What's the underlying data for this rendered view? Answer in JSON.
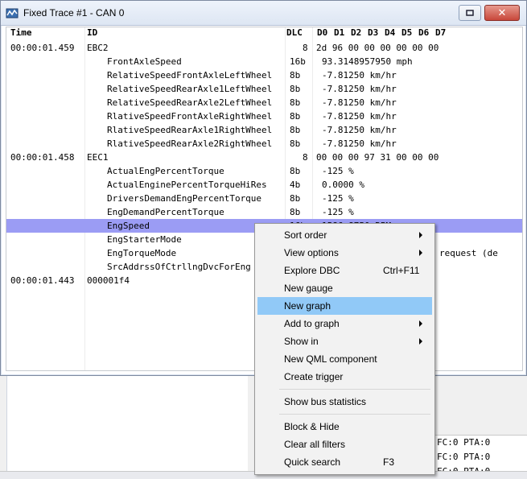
{
  "window": {
    "title": "Fixed Trace #1 - CAN 0",
    "close_glyph": "✕"
  },
  "columns": [
    "Time",
    "ID",
    "DLC",
    "D0",
    "D1",
    "D2",
    "D3",
    "D4",
    "D5",
    "D6",
    "D7"
  ],
  "rows": [
    {
      "time": "00:00:01.459",
      "id": "EBC2",
      "dlc": "8",
      "data": "2d 96 00 00 00 00 00 00"
    },
    {
      "time": "",
      "id": "FrontAxleSpeed",
      "dlc": "16b",
      "data": "93.3148957950 mph"
    },
    {
      "time": "",
      "id": "RelativeSpeedFrontAxleLeftWheel",
      "dlc": "8b",
      "data": "-7.81250 km/hr"
    },
    {
      "time": "",
      "id": "RelativeSpeedRearAxle1LeftWheel",
      "dlc": "8b",
      "data": "-7.81250 km/hr"
    },
    {
      "time": "",
      "id": "RelativeSpeedRearAxle2LeftWheel",
      "dlc": "8b",
      "data": "-7.81250 km/hr"
    },
    {
      "time": "",
      "id": "RlativeSpeedFrontAxleRightWheel",
      "dlc": "8b",
      "data": "-7.81250 km/hr"
    },
    {
      "time": "",
      "id": "RlativeSpeedRearAxle1RightWheel",
      "dlc": "8b",
      "data": "-7.81250 km/hr"
    },
    {
      "time": "",
      "id": "RlativeSpeedRearAxle2RightWheel",
      "dlc": "8b",
      "data": "-7.81250 km/hr"
    },
    {
      "time": "00:00:01.458",
      "id": "EEC1",
      "dlc": "8",
      "data": "00 00 00 97 31 00 00 00"
    },
    {
      "time": "",
      "id": "ActualEngPercentTorque",
      "dlc": "8b",
      "data": "-125 %"
    },
    {
      "time": "",
      "id": "ActualEnginePercentTorqueHiRes",
      "dlc": "4b",
      "data": "0.0000 %"
    },
    {
      "time": "",
      "id": "DriversDemandEngPercentTorque",
      "dlc": "8b",
      "data": "-125 %"
    },
    {
      "time": "",
      "id": "EngDemandPercentTorque",
      "dlc": "8b",
      "data": "-125 %"
    },
    {
      "time": "",
      "id": "EngSpeed",
      "dlc": "16b",
      "data": "1586.8750 RPM"
    },
    {
      "time": "",
      "id": "EngStarterMode",
      "dlc": "",
      "data": ""
    },
    {
      "time": "",
      "id": "EngTorqueMode",
      "dlc": "",
      "data": "request (de"
    },
    {
      "time": "",
      "id": "SrcAddrssOfCtrllngDvcForEng",
      "dlc": "",
      "data": ""
    },
    {
      "time": "00:00:01.443",
      "id": "000001f4",
      "dlc": "",
      "data": ""
    }
  ],
  "selected_row": 13,
  "menu": {
    "items": [
      {
        "label": "Sort order",
        "submenu": true,
        "shortcut": ""
      },
      {
        "label": "View options",
        "submenu": true,
        "shortcut": ""
      },
      {
        "label": "Explore DBC",
        "submenu": false,
        "shortcut": "Ctrl+F11"
      },
      {
        "label": "New gauge",
        "submenu": false,
        "shortcut": ""
      },
      {
        "label": "New graph",
        "submenu": false,
        "shortcut": "",
        "highlighted": true
      },
      {
        "label": "Add to graph",
        "submenu": true,
        "shortcut": ""
      },
      {
        "label": "Show in",
        "submenu": true,
        "shortcut": ""
      },
      {
        "label": "New QML component",
        "submenu": false,
        "shortcut": ""
      },
      {
        "label": "Create trigger",
        "submenu": false,
        "shortcut": ""
      },
      {
        "label": "Show bus statistics",
        "submenu": false,
        "shortcut": ""
      },
      {
        "label": "Block & Hide",
        "submenu": false,
        "shortcut": ""
      },
      {
        "label": "Clear all filters",
        "submenu": false,
        "shortcut": ""
      },
      {
        "label": "Quick search",
        "submenu": false,
        "shortcut": "F3"
      }
    ]
  },
  "background_lines": [
    "FC:0 PTA:0",
    "FC:0 PTA:0",
    "FC:0 PTA:0"
  ],
  "colors": {
    "selection": "#9b9cf4",
    "menu_highlight": "#91c9f7"
  },
  "icons": {
    "app": "trace-app-icon",
    "restore": "restore-icon",
    "close": "close-icon",
    "submenu": "chevron-right-icon"
  }
}
